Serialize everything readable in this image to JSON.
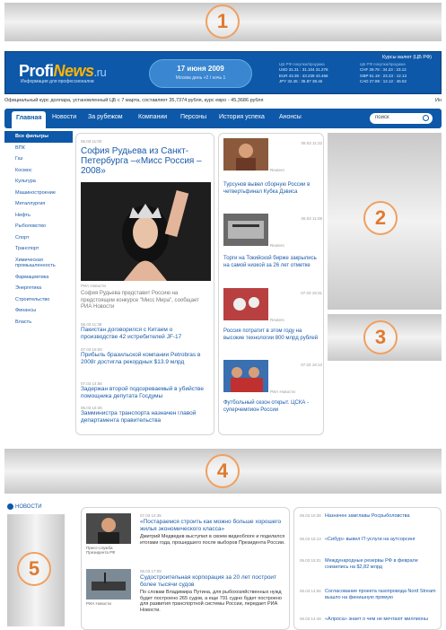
{
  "ads": {
    "ad1": "1",
    "ad2": "2",
    "ad3": "3",
    "ad4": "4",
    "ad5": "5"
  },
  "header": {
    "logo_main": "Profi",
    "logo_news": "News",
    "logo_ru": ".ru",
    "logo_sub": "Информация для профессионалов",
    "date": "17 июня 2009",
    "weather": "Москва  день +2 / ночь 1",
    "rates_title": "Курсы валют (ЦБ РФ)",
    "rates_left": [
      "ЦБ РФ   покупка/продажа",
      "USD 31.31 : 31.104 31.276",
      "EUR 43.35 : 43.239 43.466",
      "JPY 32.45 : 35.87  38.45"
    ],
    "rates_right": [
      "ЦБ РФ   покупка/продажа",
      "CHF 28.78 : 34.23 : 23.12",
      "GBP 51.19 : 23.23 : 12.13",
      "CAD 27.89 : 12.12 : 45.52"
    ]
  },
  "ticker": "Официальный курс доллара, установленный ЦБ с 7 марта, составляет 35,7374 рубля, курс евро - 45,3686 рубля",
  "ticker_right": "Ин",
  "nav": {
    "items": [
      "Главная",
      "Новости",
      "За рубежом",
      "Компании",
      "Персоны",
      "История успеха",
      "Анонсы"
    ],
    "search_placeholder": "поиск"
  },
  "categories": [
    "Все фильтры",
    "ВПК",
    "Газ",
    "Космос",
    "Культура",
    "Машиностроение",
    "Металлургия",
    "Нефть",
    "Рыболовство",
    "Спорт",
    "Транспорт",
    "Химическая промышленность",
    "Фармацевтика",
    "Энергетика",
    "Строительство",
    "Финансы",
    "Власть"
  ],
  "main": {
    "lead_meta": "06.03 11:00",
    "lead_title": "София Рудьева из Санкт-Петербурга –«Мисс Россия – 2008»",
    "photo_credit": "РИА Новости",
    "lead_text": "София Рудьева представит Россию на предстоящем конкурсе \"Мисс Мира\", сообщает РИА Новости",
    "items": [
      {
        "meta": "06.03 11:38",
        "title": "Пакистан договорился с Китаем о производстве 42 истребителей JF-17"
      },
      {
        "meta": "07.03 15:00",
        "title": "Прибыль бразильской компании Petrobras в 2008г достигла рекордных $13.9 млрд"
      },
      {
        "meta": "07.03 14:56",
        "title": "Задержан второй подозреваемый в убийстве помощника депутата Госдумы"
      },
      {
        "meta": "06.03 16:36",
        "title": "Замминистра транспорта назначен главой департамента правительства"
      }
    ]
  },
  "side": [
    {
      "date": "06.03 11:22",
      "source": "Reuters",
      "title": "Турсунов вывел сборную России в четвертьфинал Кубка Дэвиса"
    },
    {
      "date": "06.03 11:05",
      "source": "Reuters",
      "title": "Торги на Токийской бирже закрылись на самой низкой за 26 лет отметке"
    },
    {
      "date": "07.03 18:31",
      "source": "Reuters",
      "title": "Россия потратит в этом году на высокие технологии 800 млрд рублей"
    },
    {
      "date": "07.03 18:12",
      "source": "РИА Новости",
      "title": "Футбольный сезон открыт. ЦСКА - суперчемпион России"
    }
  ],
  "bottom": {
    "section": "НОВОСТИ",
    "items": [
      {
        "meta": "07.03 14:35",
        "caption": "Пресс-служба Президента РФ",
        "title": "«Постараемся строить как можно больше хорошего жилья экономического класса»",
        "text": "Дмитрий Медведев выступил в своем видеоблоге и поделился итогами года, прошедшего после выборов Президента России."
      },
      {
        "meta": "06.03 17:09",
        "caption": "РИА Новости",
        "title": "Судостроительная корпорация за 20 лет построит более тысячи судов",
        "text": "По словам Владимира Путина, для рыбохозяйственных нужд будет построено 265 судов, а еще 791 судно будет построено для развития транспортной системы России, передает РИА Новости."
      }
    ],
    "right": [
      {
        "time": "06.03 15:38",
        "text": "Назначен замглавы Росрыболовства"
      },
      {
        "time": "06.03 15:13",
        "text": "«Сибур» вывел IT-услуги на аутсорсинг"
      },
      {
        "time": "06.03 15:01",
        "text": "Международные резервы РФ в феврале снизились на $2,82 млрд"
      },
      {
        "time": "06.03 14:56",
        "text": "Согласование проекта газопровода Nord Stream вышло на финишную прямую"
      },
      {
        "time": "06.03 14:48",
        "text": "«Алроса» знает о чем не мечтают миллионы"
      }
    ]
  }
}
